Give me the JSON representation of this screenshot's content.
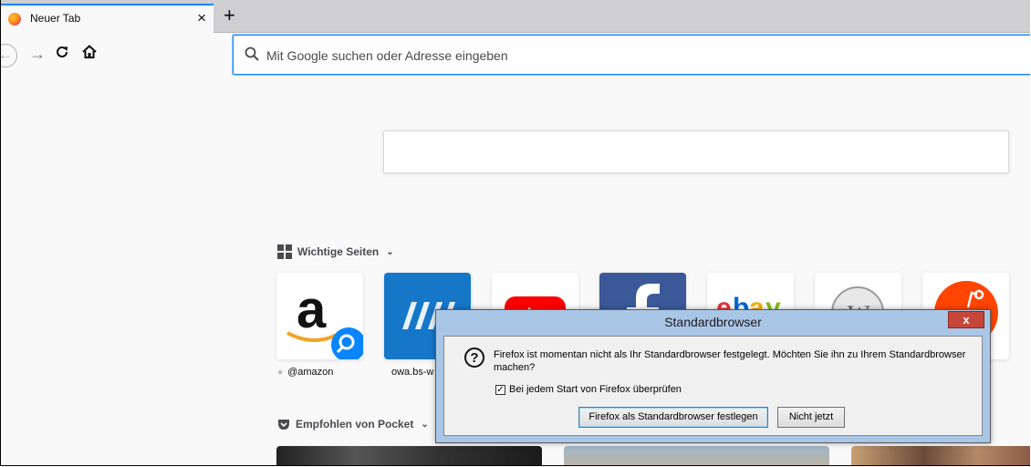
{
  "tab": {
    "title": "Neuer Tab",
    "close": "×"
  },
  "newtab": "+",
  "urlbar": {
    "placeholder": "Mit Google suchen oder Adresse eingeben"
  },
  "topsites": {
    "heading": "Wichtige Seiten",
    "tiles": [
      {
        "label": "@amazon",
        "icon": "amazon-icon",
        "pinned": true
      },
      {
        "label": "owa.bs-w",
        "icon": "owa-icon"
      },
      {
        "label": "",
        "icon": "youtube-icon"
      },
      {
        "label": "",
        "icon": "facebook-icon"
      },
      {
        "label": "",
        "icon": "ebay-icon"
      },
      {
        "label": "",
        "icon": "wikipedia-icon"
      },
      {
        "label": "",
        "icon": "reddit-icon"
      }
    ]
  },
  "pocket": {
    "heading": "Empfohlen von Pocket"
  },
  "dialog": {
    "title": "Standardbrowser",
    "close": "x",
    "message": "Firefox ist momentan nicht als Ihr Standardbrowser festgelegt. Möchten Sie ihn zu Ihrem Standardbrowser machen?",
    "checkbox_label": "Bei jedem Start von Firefox überprüfen",
    "checkbox_checked": true,
    "primary_button": "Firefox als Standardbrowser festlegen",
    "secondary_button": "Nicht jetzt"
  },
  "colors": {
    "accent": "#0a84ff",
    "dialog_frame": "#a9c6e6",
    "dialog_close": "#c7463a"
  }
}
